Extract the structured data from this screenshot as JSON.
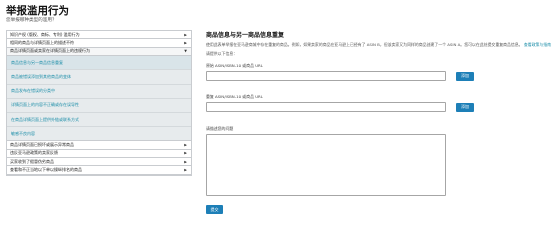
{
  "page": {
    "title": "举报滥用行为",
    "subtitle": "您举报哪种类型的滥用？"
  },
  "accordion": {
    "top_items": [
      {
        "label": "知识产权 (版权、商标、专利) 滥用行为"
      },
      {
        "label": "相同的商品与详情页面上的描述不符"
      }
    ],
    "open_item": {
      "label": "商品详情页面或卖家在详情页面上的违规行为"
    },
    "sub_items": [
      {
        "label": "商品信息与另一商品信息重复"
      },
      {
        "label": "商品被错误添加到其他商品的变体"
      },
      {
        "label": "商品发布在错误的分类中"
      },
      {
        "label": "详情页面上的内容不正确或存在误导性"
      },
      {
        "label": "在商品详情页面上提供外链或联系方式"
      },
      {
        "label": "敏感不良内容"
      }
    ],
    "bottom_items": [
      {
        "label": "商品详情页面已损坏或展示异常商品"
      },
      {
        "label": "违反亚马逊政策的卖家反馈"
      },
      {
        "label": "买家收到了假冒伪劣商品"
      },
      {
        "label": "查看和不正当地以下单以操纵排名的商品"
      }
    ]
  },
  "form": {
    "title": "商品信息与另一商品信息重复",
    "description": "使用此表单举报在亚马逊商城中存在重复的商品。例如，如果卖家的商品在亚马逊上已经有了 ASIN B，但该卖家又为同样的商品创建了一个 ASIN A。您可以在此处提交重复商品信息。",
    "description_link": "查看政策与指南",
    "prompt": "请提供以下信息：",
    "field1_label": "原始 ASIN/ISBN-10 或商品 URL",
    "field2_label": "重复 ASIN/ISBN-10 或商品 URL",
    "add_label": "添加",
    "notes_label": "请描述您的问题",
    "submit_label": "提交"
  },
  "colors": {
    "accent": "#1d7fb7",
    "link": "#1a8da8",
    "panel_bg": "#e7ebed"
  }
}
